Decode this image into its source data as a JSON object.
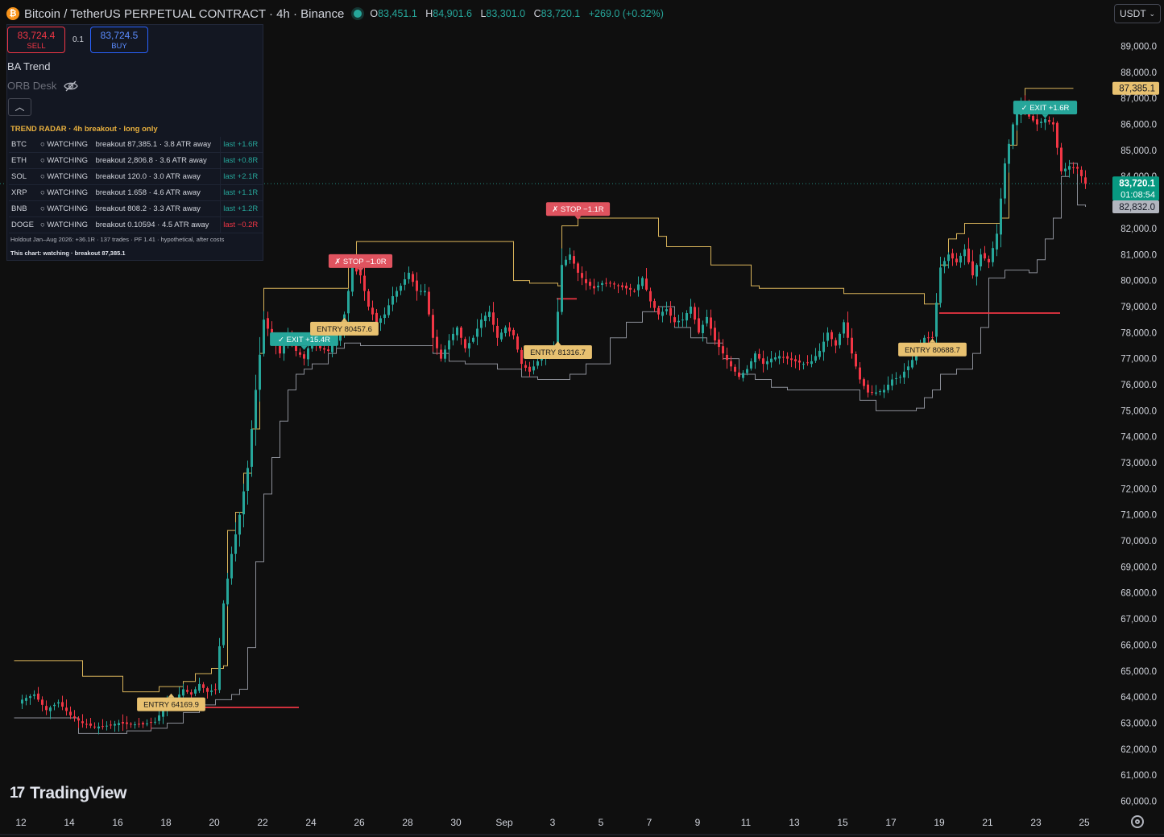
{
  "header": {
    "title": "Bitcoin / TetherUS PERPETUAL CONTRACT · 4h · Binance",
    "coin_icon": "₿",
    "ohlc": [
      {
        "k": "O",
        "v": "83,451.1"
      },
      {
        "k": "H",
        "v": "84,901.6"
      },
      {
        "k": "L",
        "v": "83,301.0"
      },
      {
        "k": "C",
        "v": "83,720.1"
      }
    ],
    "change": "+269.0 (+0.32%)",
    "currency": "USDT"
  },
  "trade": {
    "sell_price": "83,724.4",
    "sell_label": "SELL",
    "qty": "0.1",
    "buy_price": "83,724.5",
    "buy_label": "BUY"
  },
  "indicators": [
    "BA Trend",
    "ORB Desk"
  ],
  "radar": {
    "title": "TREND RADAR · 4h breakout · long only",
    "rows": [
      {
        "sym": "BTC",
        "status": "○ WATCHING",
        "info": "breakout 87,385.1 · 3.8 ATR away",
        "last": "last +1.6R"
      },
      {
        "sym": "ETH",
        "status": "○ WATCHING",
        "info": "breakout 2,806.8 · 3.6 ATR away",
        "last": "last +0.8R"
      },
      {
        "sym": "SOL",
        "status": "○ WATCHING",
        "info": "breakout 120.0 · 3.0 ATR away",
        "last": "last +2.1R"
      },
      {
        "sym": "XRP",
        "status": "○ WATCHING",
        "info": "breakout 1.658 · 4.6 ATR away",
        "last": "last +1.1R"
      },
      {
        "sym": "BNB",
        "status": "○ WATCHING",
        "info": "breakout 808.2 · 3.3 ATR away",
        "last": "last +1.2R"
      },
      {
        "sym": "DOGE",
        "status": "○ WATCHING",
        "info": "breakout 0.10594 · 4.5 ATR away",
        "last": "last −0.2R"
      }
    ],
    "holdout": "Holdout Jan–Aug 2026: +36.1R · 137 trades · PF 1.41 · hypothetical, after costs",
    "this_chart": "This chart: watching · breakout 87,385.1"
  },
  "brand": "TradingView",
  "colors": {
    "up": "#26a69a",
    "down": "#f23645",
    "upper_band": "#d9b45a",
    "lower_band": "#8c8f98",
    "entry_tag": "#e8c170"
  },
  "chart_data": {
    "type": "candlestick",
    "x_ticks": [
      {
        "label": "12",
        "i": 0
      },
      {
        "label": "14",
        "i": 12
      },
      {
        "label": "16",
        "i": 24
      },
      {
        "label": "18",
        "i": 36
      },
      {
        "label": "20",
        "i": 48
      },
      {
        "label": "22",
        "i": 60
      },
      {
        "label": "24",
        "i": 72
      },
      {
        "label": "26",
        "i": 84
      },
      {
        "label": "28",
        "i": 96
      },
      {
        "label": "30",
        "i": 108
      },
      {
        "label": "Sep",
        "i": 120
      },
      {
        "label": "3",
        "i": 132
      },
      {
        "label": "5",
        "i": 144
      },
      {
        "label": "7",
        "i": 156
      },
      {
        "label": "9",
        "i": 168
      },
      {
        "label": "11",
        "i": 180
      },
      {
        "label": "13",
        "i": 192
      },
      {
        "label": "15",
        "i": 204
      },
      {
        "label": "17",
        "i": 216
      },
      {
        "label": "19",
        "i": 228
      },
      {
        "label": "21",
        "i": 240
      },
      {
        "label": "23",
        "i": 252
      },
      {
        "label": "25",
        "i": 264
      }
    ],
    "y_ticks": [
      60000,
      61000,
      62000,
      63000,
      64000,
      65000,
      66000,
      67000,
      68000,
      69000,
      70000,
      71000,
      72000,
      73000,
      74000,
      75000,
      76000,
      77000,
      78000,
      79000,
      80000,
      81000,
      82000,
      83000,
      84000,
      85000,
      86000,
      87000,
      88000,
      89000
    ],
    "ylim": [
      59750,
      89500
    ],
    "price_tags": [
      {
        "label": "87,385.1",
        "value": 87385.1,
        "kind": "band"
      },
      {
        "label": "83,720.1",
        "value": 83720.1,
        "kind": "last",
        "countdown": "01:08:54"
      },
      {
        "label": "82,832.0",
        "value": 82832.0,
        "kind": "lower"
      }
    ],
    "close_waypoints": [
      [
        0,
        63900
      ],
      [
        3,
        64100
      ],
      [
        6,
        63500
      ],
      [
        9,
        63800
      ],
      [
        12,
        63300
      ],
      [
        15,
        63000
      ],
      [
        18,
        62850
      ],
      [
        21,
        62900
      ],
      [
        24,
        63000
      ],
      [
        27,
        62950
      ],
      [
        30,
        62950
      ],
      [
        33,
        63050
      ],
      [
        36,
        63800
      ],
      [
        38,
        63900
      ],
      [
        40,
        64300
      ],
      [
        42,
        64100
      ],
      [
        44,
        64500
      ],
      [
        46,
        64200
      ],
      [
        48,
        64300
      ],
      [
        50,
        67600
      ],
      [
        52,
        69500
      ],
      [
        54,
        71000
      ],
      [
        56,
        72800
      ],
      [
        58,
        75800
      ],
      [
        60,
        78500
      ],
      [
        62,
        77800
      ],
      [
        64,
        77200
      ],
      [
        66,
        77900
      ],
      [
        68,
        77300
      ],
      [
        70,
        77000
      ],
      [
        72,
        77800
      ],
      [
        74,
        77400
      ],
      [
        76,
        77300
      ],
      [
        78,
        77700
      ],
      [
        80,
        78700
      ],
      [
        82,
        80500
      ],
      [
        84,
        80200
      ],
      [
        86,
        79000
      ],
      [
        88,
        78400
      ],
      [
        90,
        78700
      ],
      [
        92,
        79400
      ],
      [
        94,
        79800
      ],
      [
        96,
        80300
      ],
      [
        98,
        79600
      ],
      [
        100,
        79600
      ],
      [
        102,
        77800
      ],
      [
        104,
        77000
      ],
      [
        106,
        77700
      ],
      [
        108,
        78200
      ],
      [
        110,
        77400
      ],
      [
        112,
        77800
      ],
      [
        114,
        78500
      ],
      [
        116,
        78800
      ],
      [
        118,
        77800
      ],
      [
        120,
        78200
      ],
      [
        122,
        77900
      ],
      [
        124,
        76800
      ],
      [
        126,
        76500
      ],
      [
        128,
        76900
      ],
      [
        130,
        77200
      ],
      [
        132,
        77400
      ],
      [
        133,
        78800
      ],
      [
        134,
        80600
      ],
      [
        136,
        81000
      ],
      [
        138,
        80300
      ],
      [
        140,
        79900
      ],
      [
        142,
        79700
      ],
      [
        144,
        79900
      ],
      [
        146,
        79900
      ],
      [
        148,
        79800
      ],
      [
        150,
        79700
      ],
      [
        152,
        79600
      ],
      [
        154,
        80100
      ],
      [
        156,
        79200
      ],
      [
        158,
        78700
      ],
      [
        160,
        78900
      ],
      [
        162,
        78400
      ],
      [
        164,
        78500
      ],
      [
        166,
        79000
      ],
      [
        168,
        78000
      ],
      [
        170,
        78600
      ],
      [
        172,
        77700
      ],
      [
        174,
        77200
      ],
      [
        176,
        76700
      ],
      [
        178,
        76300
      ],
      [
        180,
        76600
      ],
      [
        182,
        77200
      ],
      [
        184,
        76800
      ],
      [
        186,
        77000
      ],
      [
        188,
        77100
      ],
      [
        190,
        77000
      ],
      [
        192,
        76900
      ],
      [
        194,
        76800
      ],
      [
        196,
        76900
      ],
      [
        198,
        77300
      ],
      [
        200,
        78000
      ],
      [
        202,
        77500
      ],
      [
        204,
        78400
      ],
      [
        206,
        77200
      ],
      [
        208,
        76200
      ],
      [
        210,
        75700
      ],
      [
        212,
        75700
      ],
      [
        214,
        75800
      ],
      [
        216,
        76200
      ],
      [
        218,
        76300
      ],
      [
        220,
        76700
      ],
      [
        222,
        77200
      ],
      [
        224,
        77800
      ],
      [
        226,
        77800
      ],
      [
        228,
        80500
      ],
      [
        230,
        81000
      ],
      [
        232,
        80700
      ],
      [
        234,
        81200
      ],
      [
        236,
        80200
      ],
      [
        238,
        81000
      ],
      [
        240,
        80700
      ],
      [
        242,
        81800
      ],
      [
        244,
        84500
      ],
      [
        246,
        86000
      ],
      [
        248,
        86800
      ],
      [
        250,
        86300
      ],
      [
        252,
        86000
      ],
      [
        254,
        86200
      ],
      [
        256,
        86000
      ],
      [
        258,
        84200
      ],
      [
        260,
        84400
      ],
      [
        262,
        84300
      ],
      [
        264,
        83720
      ]
    ],
    "upper_band_steps": [
      [
        -2,
        65400
      ],
      [
        13,
        65400
      ],
      [
        15,
        64800
      ],
      [
        24,
        64800
      ],
      [
        25,
        64200
      ],
      [
        33,
        64200
      ],
      [
        34,
        64400
      ],
      [
        40,
        64600
      ],
      [
        43,
        64900
      ],
      [
        47,
        65100
      ],
      [
        50,
        65200
      ],
      [
        51,
        70400
      ],
      [
        53,
        71100
      ],
      [
        55,
        72600
      ],
      [
        57,
        74300
      ],
      [
        59,
        77200
      ],
      [
        60,
        79700
      ],
      [
        80,
        79700
      ],
      [
        81,
        80700
      ],
      [
        83,
        81500
      ],
      [
        103,
        81500
      ],
      [
        121,
        81500
      ],
      [
        122,
        80000
      ],
      [
        126,
        79900
      ],
      [
        133,
        79800
      ],
      [
        134,
        82100
      ],
      [
        138,
        82400
      ],
      [
        157,
        82400
      ],
      [
        158,
        81700
      ],
      [
        160,
        81300
      ],
      [
        168,
        81300
      ],
      [
        171,
        80600
      ],
      [
        179,
        80600
      ],
      [
        181,
        79800
      ],
      [
        183,
        79700
      ],
      [
        203,
        79700
      ],
      [
        204,
        79500
      ],
      [
        222,
        79500
      ],
      [
        224,
        79100
      ],
      [
        226,
        79100
      ],
      [
        228,
        80600
      ],
      [
        230,
        81600
      ],
      [
        232,
        81800
      ],
      [
        234,
        82200
      ],
      [
        240,
        82200
      ],
      [
        243,
        82400
      ],
      [
        245,
        85200
      ],
      [
        247,
        86800
      ],
      [
        249,
        87385
      ],
      [
        256,
        87385
      ],
      [
        261,
        87385
      ]
    ],
    "lower_band_steps": [
      [
        -2,
        63200
      ],
      [
        12,
        63200
      ],
      [
        14,
        62600
      ],
      [
        24,
        62600
      ],
      [
        26,
        62700
      ],
      [
        32,
        62800
      ],
      [
        36,
        63000
      ],
      [
        40,
        63400
      ],
      [
        44,
        63700
      ],
      [
        48,
        63900
      ],
      [
        52,
        64100
      ],
      [
        54,
        64300
      ],
      [
        56,
        65900
      ],
      [
        58,
        69200
      ],
      [
        60,
        71800
      ],
      [
        62,
        73200
      ],
      [
        64,
        74600
      ],
      [
        66,
        75800
      ],
      [
        68,
        76400
      ],
      [
        70,
        76600
      ],
      [
        72,
        76800
      ],
      [
        76,
        77200
      ],
      [
        78,
        77400
      ],
      [
        80,
        77600
      ],
      [
        84,
        77500
      ],
      [
        98,
        77500
      ],
      [
        102,
        77200
      ],
      [
        106,
        76900
      ],
      [
        110,
        76800
      ],
      [
        118,
        76600
      ],
      [
        124,
        76300
      ],
      [
        128,
        76200
      ],
      [
        136,
        76400
      ],
      [
        140,
        76800
      ],
      [
        146,
        77800
      ],
      [
        150,
        78400
      ],
      [
        154,
        78800
      ],
      [
        158,
        79000
      ],
      [
        162,
        78200
      ],
      [
        166,
        77800
      ],
      [
        170,
        77600
      ],
      [
        174,
        77000
      ],
      [
        178,
        76400
      ],
      [
        182,
        76200
      ],
      [
        186,
        75900
      ],
      [
        190,
        75800
      ],
      [
        206,
        75800
      ],
      [
        208,
        75400
      ],
      [
        212,
        75000
      ],
      [
        218,
        75000
      ],
      [
        222,
        75100
      ],
      [
        224,
        75500
      ],
      [
        226,
        75800
      ],
      [
        228,
        76400
      ],
      [
        232,
        76600
      ],
      [
        236,
        77200
      ],
      [
        238,
        78200
      ],
      [
        240,
        80100
      ],
      [
        244,
        80400
      ],
      [
        250,
        80300
      ],
      [
        252,
        80800
      ],
      [
        254,
        81600
      ],
      [
        256,
        82400
      ],
      [
        258,
        84000
      ],
      [
        260,
        84500
      ],
      [
        262,
        82900
      ],
      [
        264,
        82832
      ]
    ],
    "signals": [
      {
        "kind": "entry",
        "label": "ENTRY 64169.9",
        "i": 37,
        "value": 64169.9
      },
      {
        "kind": "exit",
        "label": "✓ EXIT +15.4R",
        "i": 70,
        "value": 77300
      },
      {
        "kind": "entry",
        "label": "ENTRY 80457.6",
        "i": 80,
        "value": 78600
      },
      {
        "kind": "stop",
        "label": "✗ STOP −1.0R",
        "i": 84,
        "value": 80300
      },
      {
        "kind": "entry",
        "label": "ENTRY 81316.7",
        "i": 133,
        "value": 77700
      },
      {
        "kind": "stop",
        "label": "✗ STOP −1.1R",
        "i": 138,
        "value": 82300
      },
      {
        "kind": "entry",
        "label": "ENTRY 80688.7",
        "i": 226,
        "value": 77800
      },
      {
        "kind": "exit",
        "label": "✓ EXIT +1.6R",
        "i": 254,
        "value": 86200
      }
    ],
    "stop_lines": [
      {
        "from": 37,
        "to": 69,
        "value": 63600
      },
      {
        "from": 133,
        "to": 138,
        "value": 79300
      },
      {
        "from": 228,
        "to": 258,
        "value": 78750
      }
    ],
    "last_price": 83720.1
  }
}
